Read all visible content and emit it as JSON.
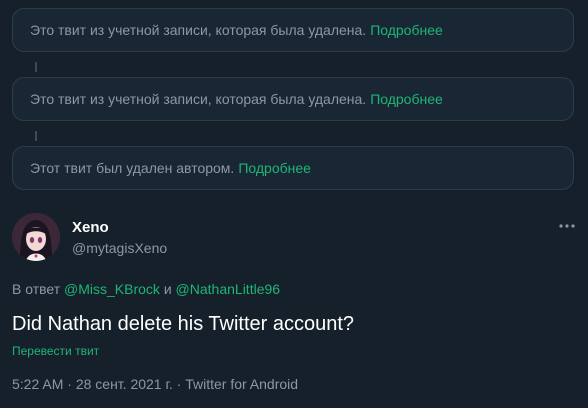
{
  "notices": [
    {
      "text": "Это твит из учетной записи, которая была удалена.",
      "link": "Подробнее"
    },
    {
      "text": "Это твит из учетной записи, которая была удалена.",
      "link": "Подробнее"
    },
    {
      "text": "Этот твит был удален автором.",
      "link": "Подробнее"
    }
  ],
  "tweet": {
    "display_name": "Xeno",
    "handle": "@mytagisXeno",
    "more_icon": "more-horizontal-icon",
    "reply_prefix": "В ответ",
    "mention1": "@Miss_KBrock",
    "conjunction": "и",
    "mention2": "@NathanLittle96",
    "text": "Did Nathan delete his Twitter account?",
    "translate_label": "Перевести твит",
    "time": "5:22 AM",
    "separator": "·",
    "date": "28 сент. 2021 г.",
    "source": "Twitter for Android"
  },
  "colors": {
    "background": "#15202b",
    "card": "#192734",
    "accent": "#1eb575",
    "secondary_text": "#8b98a5"
  }
}
